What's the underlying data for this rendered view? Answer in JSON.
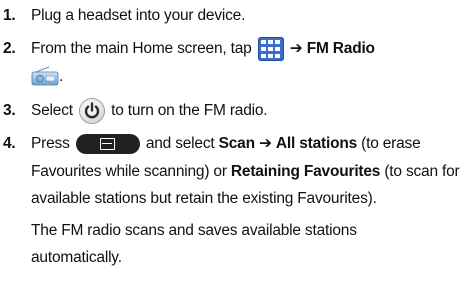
{
  "steps": [
    {
      "num": "1.",
      "text": "Plug a headset into your device."
    },
    {
      "num": "2.",
      "text_before": "From the main Home screen, tap",
      "apps_icon": "apps-grid-icon",
      "arrow": "➔",
      "bold_label": "FM Radio",
      "radio_icon": "fm-radio-app-icon",
      "text_after": "."
    },
    {
      "num": "3.",
      "text_before": "Select",
      "power_icon": "power-icon",
      "text_after": "to turn on the FM radio."
    },
    {
      "num": "4.",
      "press": "Press",
      "menu_key": "menu-key-icon",
      "and_select": "and select",
      "scan": "Scan",
      "arrow": "➔",
      "all_stations": "All stations",
      "all_stations_note": "(to erase Favourites while scanning) or",
      "retaining_line1": "Retaining",
      "retaining_line2": "Favourites",
      "retaining_note": "(to scan for available stations but retain the existing Favourites).",
      "result_line1": "The FM radio scans and saves available stations",
      "result_line2": "automatically."
    }
  ],
  "colors": {
    "text": "#111111",
    "apps_icon_bg": "#3a6fd0",
    "menu_key_bg": "#222222"
  }
}
